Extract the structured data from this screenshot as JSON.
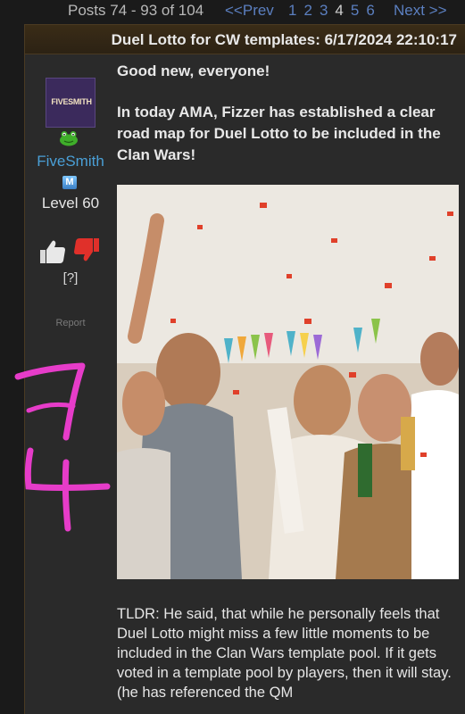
{
  "pagination": {
    "count_text": "Posts 74 - 93 of 104",
    "prev_label": "<<Prev",
    "pages": [
      "1",
      "2",
      "3",
      "4",
      "5",
      "6"
    ],
    "current_page": "4",
    "next_label": "Next >>"
  },
  "post": {
    "title": "Duel Lotto for CW templates: 6/17/2024 22:10:17",
    "author": {
      "avatar_text": "FIVESMITH",
      "name": "FiveSmith",
      "member_badge": "M",
      "level": "Level 60",
      "rating_unknown": "[?]",
      "report_label": "Report",
      "frog_icon": "frog-icon",
      "thumbs_up_icon": "thumbs-up-icon",
      "thumbs_down_icon": "thumbs-down-icon"
    },
    "heading": "Good new, everyone!",
    "paragraph": "In today AMA, Fizzer has established a clear road map for Duel Lotto to be included in the Clan Wars!",
    "tldr": "TLDR: He said, that while he personally feels that Duel Lotto might miss a few little moments to be included in the Clan Wars template pool. If it gets voted in a template pool by players, then it will stay. (he has referenced the QM"
  },
  "colors": {
    "link": "#5b7fc0",
    "username": "#4a9fd6",
    "header_bg": "#3a2c17",
    "post_bg": "#2a2a2a",
    "scribble": "#e63cc9",
    "thumbs_down": "#e0302a"
  }
}
